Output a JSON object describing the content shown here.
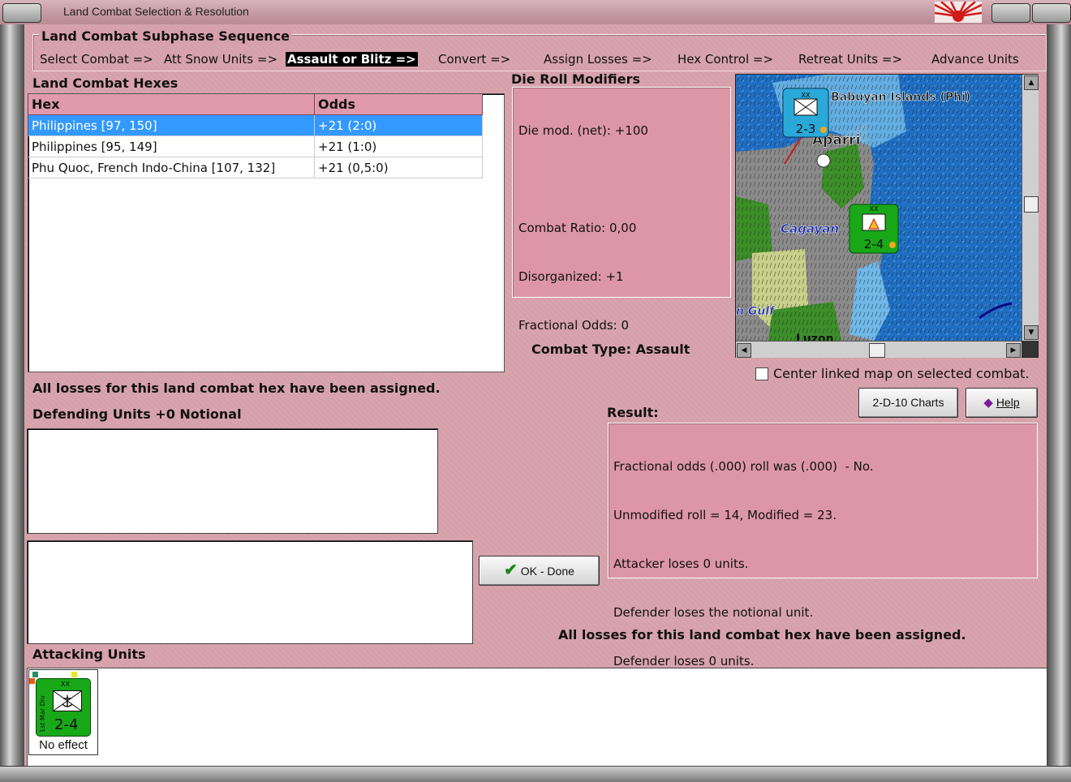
{
  "window": {
    "title": "Land Combat Selection & Resolution"
  },
  "sequence": {
    "title": "Land Combat Subphase Sequence",
    "steps": [
      "Select Combat =>",
      "Att Snow Units =>",
      "Assault or Blitz =>",
      "Convert =>",
      "Assign Losses =>",
      "Hex Control =>",
      "Retreat Units =>",
      "Advance Units"
    ],
    "active_step": "Assault or Blitz =>"
  },
  "hexes": {
    "label": "Land Combat Hexes",
    "columns": [
      "Hex",
      "Odds"
    ],
    "rows": [
      {
        "hex": "Philippines [97, 150]",
        "odds": "+21 (2:0)"
      },
      {
        "hex": "Philippines [95, 149]",
        "odds": "+21 (1:0)"
      },
      {
        "hex": "Phu Quoc, French Indo-China [107, 132]",
        "odds": "+21 (0,5:0)"
      }
    ],
    "selected_row": 0
  },
  "die_roll": {
    "label": "Die Roll Modifiers",
    "lines": [
      "Die mod. (net): +100",
      "",
      "Combat Ratio: 0,00",
      "Disorganized: +1",
      "Fractional Odds: 0"
    ]
  },
  "map": {
    "labels": {
      "islands": "Babuyan Islands (Phi)",
      "town": "Aparri",
      "region": "Cagayan",
      "gulf": "n Gulf",
      "luzon": "Luzon"
    },
    "counters": [
      {
        "name": "1st Mar Div",
        "type": "marine",
        "strength": "2-3",
        "size": "XX",
        "color": "#2aa8d8"
      },
      {
        "name": "1st Mar Div",
        "type": "infantry",
        "strength": "2-4",
        "size": "XX",
        "color": "#18a818"
      }
    ],
    "center_linked_label": "Center linked map on selected combat.",
    "center_linked_checked": false
  },
  "combat_type": {
    "label": "Combat Type:",
    "value": "Assault"
  },
  "losses_msg": "All losses for this land combat hex have been assigned.",
  "defending": {
    "label": "Defending Units +0 Notional"
  },
  "buttons": {
    "charts": "2-D-10 Charts",
    "help": "Help",
    "ok": "OK - Done"
  },
  "result": {
    "label": "Result:",
    "lines": [
      "Fractional odds (.000) roll was (.000)  - No.",
      "Unmodified roll = 14, Modified = 23.",
      "Attacker loses 0 units.",
      "Defender loses the notional unit.",
      "Defender loses 0 units."
    ]
  },
  "attacking": {
    "label": "Attacking Units",
    "units": [
      {
        "name": "1st Mar Div",
        "strength": "2-4",
        "size": "XX",
        "status": "No effect",
        "color": "#18a818"
      }
    ]
  },
  "colors": {
    "panel": "#d6a0ab",
    "header": "#e09aab",
    "selection": "#3399ff"
  }
}
